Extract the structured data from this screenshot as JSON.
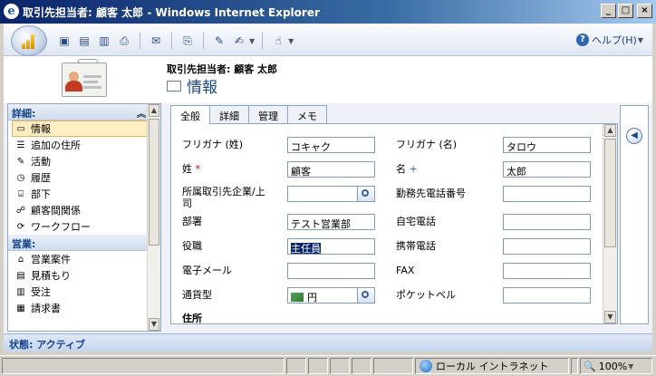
{
  "window": {
    "title": "取引先担当者: 顧客 太郎 - Windows Internet Explorer"
  },
  "toolbar": {
    "help_label": "ヘルプ(H)"
  },
  "header": {
    "entity_label": "取引先担当者: 顧客 太郎",
    "page_title": "情報"
  },
  "nav": {
    "sections": [
      {
        "title": "詳細:",
        "items": [
          "情報",
          "追加の住所",
          "活動",
          "履歴",
          "部下",
          "顧客間関係",
          "ワークフロー"
        ]
      },
      {
        "title": "営業:",
        "items": [
          "営業案件",
          "見積もり",
          "受注",
          "請求書"
        ]
      }
    ]
  },
  "tabs": [
    "全般",
    "詳細",
    "管理",
    "メモ"
  ],
  "form": {
    "left": [
      {
        "label": "フリガナ (姓)",
        "value": "コキャク"
      },
      {
        "label": "姓",
        "marker": "*",
        "value": "顧客"
      },
      {
        "label": "所属取引先企業/上",
        "label2": "司",
        "value": ""
      },
      {
        "label": "部署",
        "value": "テスト営業部"
      },
      {
        "label": "役職",
        "value": "主任員"
      },
      {
        "label": "電子メール",
        "value": ""
      },
      {
        "label": "通貨型",
        "value": "円"
      }
    ],
    "right": [
      {
        "label": "フリガナ (名)",
        "value": "タロウ"
      },
      {
        "label": "名",
        "marker": "+",
        "value": "太郎"
      },
      {
        "label": "勤務先電話番号",
        "value": ""
      },
      {
        "label": "自宅電話",
        "value": ""
      },
      {
        "label": "携帯電話",
        "value": ""
      },
      {
        "label": "FAX",
        "value": ""
      },
      {
        "label": "ポケットベル",
        "value": ""
      }
    ],
    "section_title": "住所"
  },
  "status": {
    "text": "状態: アクティブ"
  },
  "ie_status": {
    "zone": "ローカル イントラネット",
    "zoom": "100%"
  },
  "colors": {
    "required": "#cc0000",
    "recommended": "#2f5fb0",
    "title_bar": "#0a246a"
  }
}
